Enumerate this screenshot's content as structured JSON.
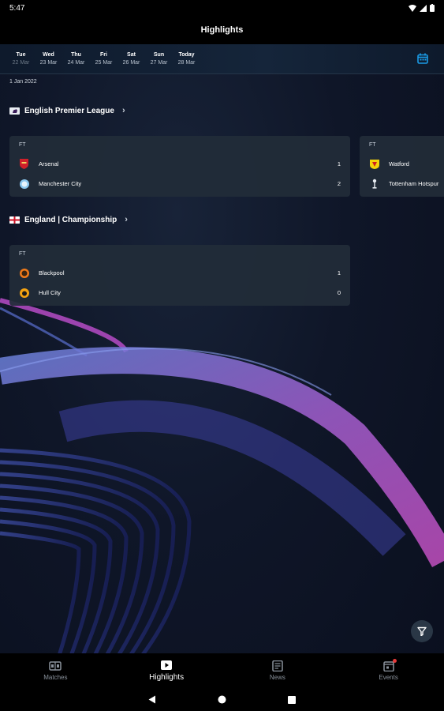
{
  "status_bar": {
    "time": "5:47"
  },
  "app_bar": {
    "title": "Highlights"
  },
  "date_strip": {
    "items": [
      {
        "day": "Tue",
        "date": "22 Mar"
      },
      {
        "day": "Wed",
        "date": "23 Mar"
      },
      {
        "day": "Thu",
        "date": "24 Mar"
      },
      {
        "day": "Fri",
        "date": "25 Mar"
      },
      {
        "day": "Sat",
        "date": "26 Mar"
      },
      {
        "day": "Sun",
        "date": "27 Mar"
      },
      {
        "day": "Today",
        "date": "28 Mar"
      }
    ]
  },
  "section_date": "1 Jan 2022",
  "leagues": [
    {
      "name": "English Premier League",
      "matches": [
        {
          "status": "FT",
          "home": {
            "name": "Arsenal",
            "score": "1"
          },
          "away": {
            "name": "Manchester City",
            "score": "2"
          }
        },
        {
          "status": "FT",
          "home": {
            "name": "Watford"
          },
          "away": {
            "name": "Tottenham Hotspur"
          }
        }
      ]
    },
    {
      "name": "England | Championship",
      "matches": [
        {
          "status": "FT",
          "home": {
            "name": "Blackpool",
            "score": "1"
          },
          "away": {
            "name": "Hull City",
            "score": "0"
          }
        }
      ]
    }
  ],
  "bottom_nav": {
    "items": [
      {
        "label": "Matches",
        "icon": "scoreboard-icon"
      },
      {
        "label": "Highlights",
        "icon": "play-icon"
      },
      {
        "label": "News",
        "icon": "news-icon"
      },
      {
        "label": "Events",
        "icon": "calendar-event-icon"
      }
    ],
    "active": "Highlights"
  },
  "colors": {
    "accent": "#1a9be6",
    "card": "#222c38",
    "background": "#0f1628",
    "badge": "#e53939"
  }
}
